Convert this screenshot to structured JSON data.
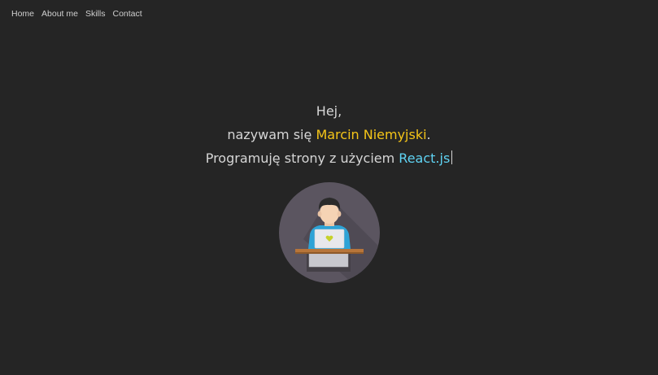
{
  "nav": {
    "items": [
      "Home",
      "About me",
      "Skills",
      "Contact"
    ]
  },
  "hero": {
    "greeting": "Hej,",
    "intro_prefix": "nazywam się ",
    "name": "Marcin Niemyjski",
    "intro_suffix": ".",
    "skill_prefix": "Programuję strony z użyciem ",
    "skill": "React.js"
  },
  "colors": {
    "background": "#252525",
    "name_accent": "#f5c518",
    "tech_accent": "#5fd3f3",
    "text": "#d6d6d6"
  },
  "icons": {
    "avatar": "developer-at-laptop-illustration"
  }
}
